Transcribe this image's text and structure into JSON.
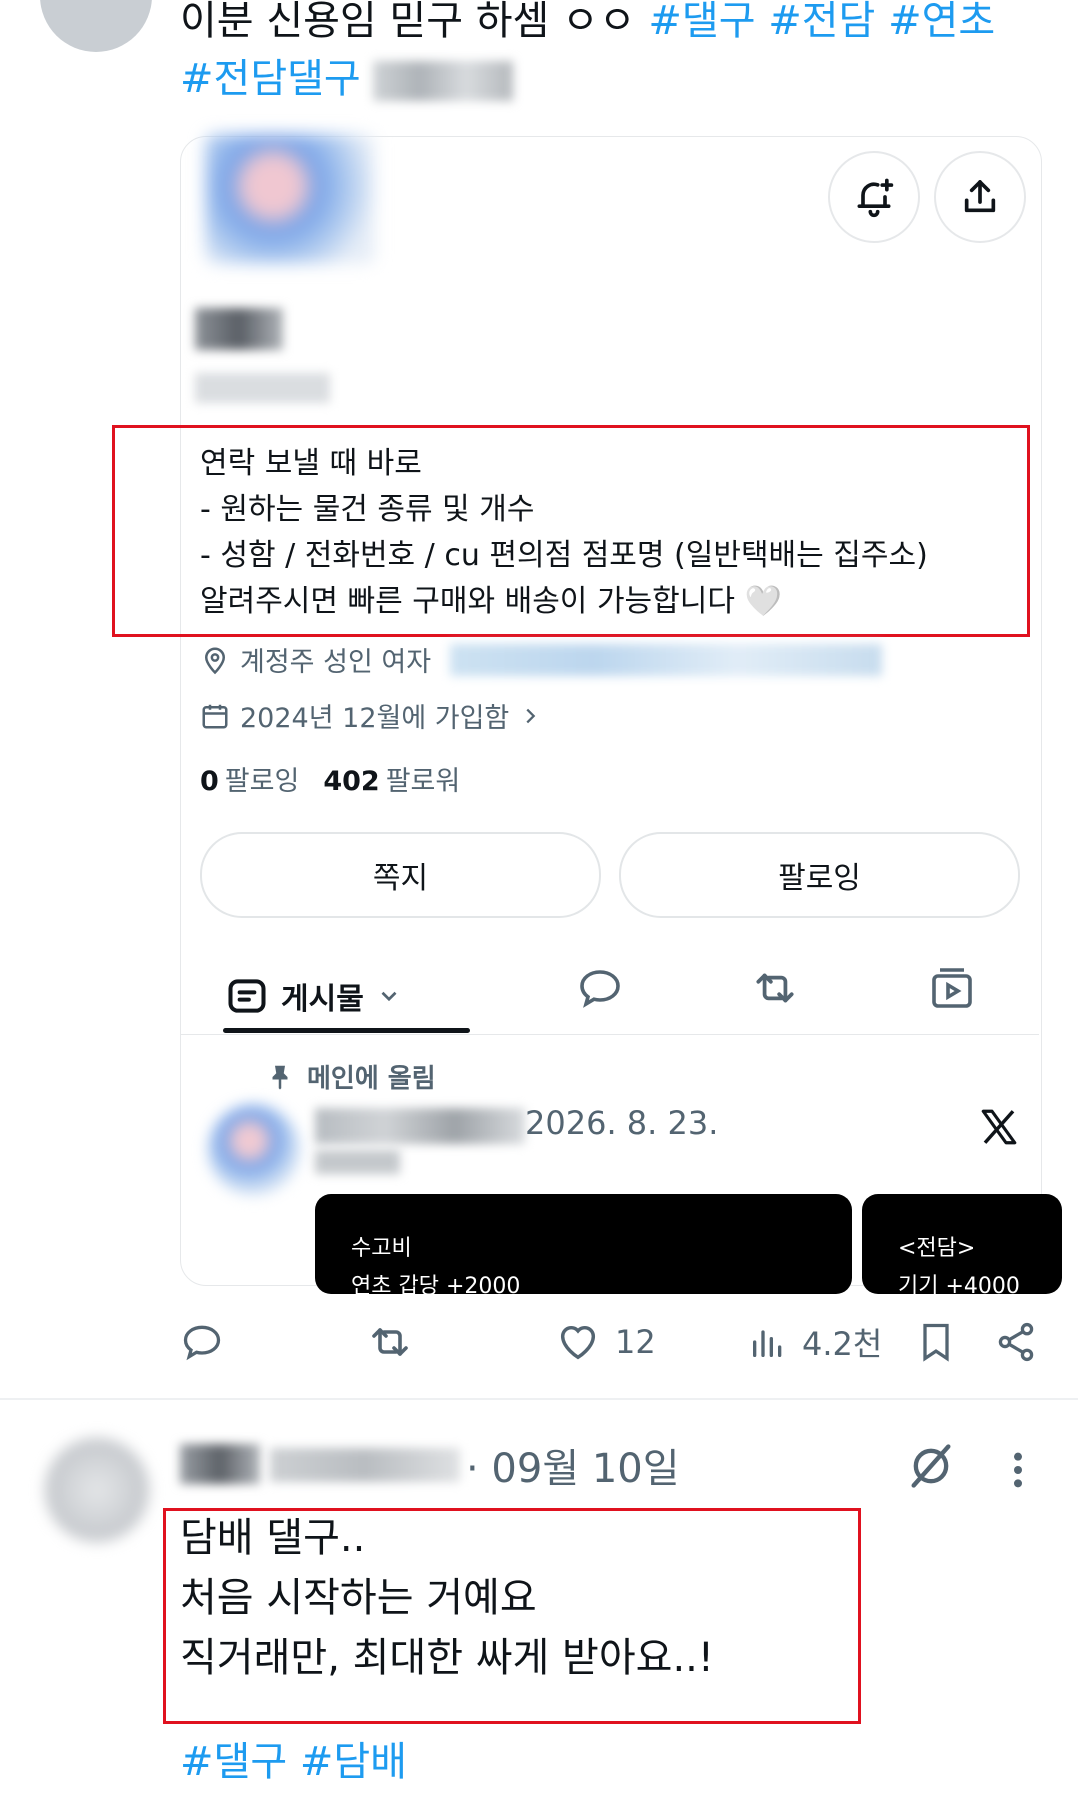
{
  "post1": {
    "text": "이분 신용임 믿구 하셈 ㅇㅇ ",
    "hashtags": [
      "#댈구",
      "#전담",
      "#연초",
      "#전담댈구"
    ],
    "card": {
      "bio_lines": [
        "연락 보낼 때 바로",
        "- 원하는 물건 종류 및 개수",
        "- 성함 / 전화번호 / cu 편의점 점포명 (일반택배는 집주소)",
        "알려주시면 빠른 구매와 배송이 가능합니다 🤍"
      ],
      "location": "계정주 성인 여자",
      "joined": "2024년 12월에 가입함",
      "following_count": "0",
      "following_label": "팔로잉",
      "followers_count": "402",
      "followers_label": "팔로워",
      "dm_button": "쪽지",
      "follow_button": "팔로잉",
      "tab_posts": "게시물",
      "pinned_label": "메인에 올림",
      "pinned_date": "2026. 8. 23.",
      "media_cards": [
        {
          "line1": "수고비",
          "line2": "연초 갑당 +2000"
        },
        {
          "line1": "<전담>",
          "line2": "기기 +4000"
        }
      ]
    },
    "actions": {
      "likes": "12",
      "views": "4.2천"
    }
  },
  "post2": {
    "time": "· 09월 10일",
    "lines": [
      "담배 댈구..",
      "처음 시작하는 거예요",
      "직거래만, 최대한 싸게 받아요..!"
    ],
    "hashtags": [
      "#댈구",
      "#담배"
    ]
  },
  "colors": {
    "accent": "#1d9bf0",
    "highlight_box": "#e0111f",
    "secondary_text": "#536471"
  }
}
